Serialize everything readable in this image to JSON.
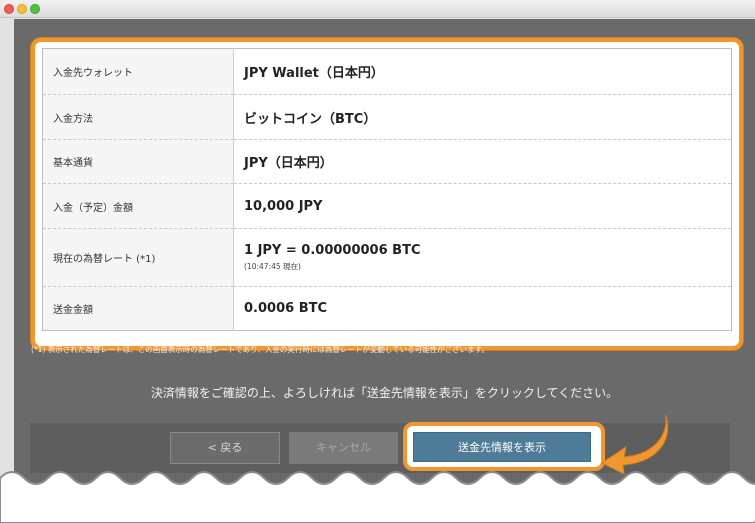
{
  "deposit_info": {
    "rows": [
      {
        "label": "入金先ウォレット",
        "value": "JPY Wallet（日本円）"
      },
      {
        "label": "入金方法",
        "value": "ビットコイン（BTC）"
      },
      {
        "label": "基本通貨",
        "value": "JPY（日本円）"
      },
      {
        "label": "入金（予定）金額",
        "value": "10,000 JPY"
      },
      {
        "label": "現在の為替レート (*1)",
        "value": "1 JPY = 0.00000006 BTC",
        "sub": "(10:47:45 現在)"
      },
      {
        "label": "送金金額",
        "value": "0.0006 BTC"
      }
    ]
  },
  "note": "(*1)  表示された為替レートは、この画面表示時の為替レートであり、入金の実行時には為替レートが変動している可能性がございます。",
  "instruction": "決済情報をご確認の上、よろしければ「送金先情報を表示」をクリックしてください。",
  "buttons": {
    "back": "< 戻る",
    "cancel": "キャンセル",
    "show_remittance": "送金先情報を表示"
  },
  "colors": {
    "highlight": "#f0972f",
    "primary_button": "#4d7b98"
  }
}
